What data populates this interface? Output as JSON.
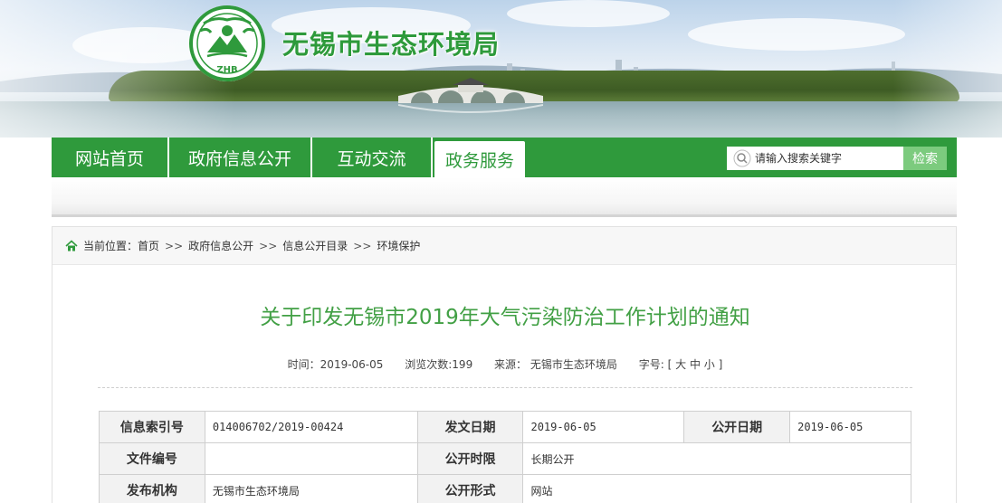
{
  "header": {
    "site_title": "无锡市生态环境局",
    "logo_text": "ZHB"
  },
  "nav": {
    "items": [
      "网站首页",
      "政府信息公开",
      "互动交流",
      "政务服务"
    ],
    "active_index": 3
  },
  "search": {
    "placeholder": "请输入搜索关键字",
    "button_label": "检索"
  },
  "breadcrumb": {
    "prefix": "当前位置：",
    "items": [
      "首页",
      "政府信息公开",
      "信息公开目录",
      "环境保护"
    ],
    "separator": ">>"
  },
  "article": {
    "title": "关于印发无锡市2019年大气污染防治工作计划的通知",
    "meta": {
      "time_label": "时间：",
      "time": "2019-06-05",
      "views_label": "浏览次数:",
      "views": "199",
      "source_label": "来源：",
      "source": "无锡市生态环境局",
      "size_label": "字号:",
      "size_open": "[",
      "size_large": "大",
      "size_medium": "中",
      "size_small": "小",
      "size_close": "]"
    }
  },
  "info_table": {
    "row1": {
      "l1": "信息索引号",
      "v1": "014006702/2019-00424",
      "l2": "发文日期",
      "v2": "2019-06-05",
      "l3": "公开日期",
      "v3": "2019-06-05"
    },
    "row2": {
      "l1": "文件编号",
      "v1": "",
      "l2": "公开时限",
      "v2": "长期公开"
    },
    "row3": {
      "l1": "发布机构",
      "v1": "无锡市生态环境局",
      "l2": "公开形式",
      "v2": "网站"
    }
  },
  "colors": {
    "brand_green": "#2f9a3c",
    "title_green": "#42a045",
    "search_button": "#7ccb7e"
  }
}
